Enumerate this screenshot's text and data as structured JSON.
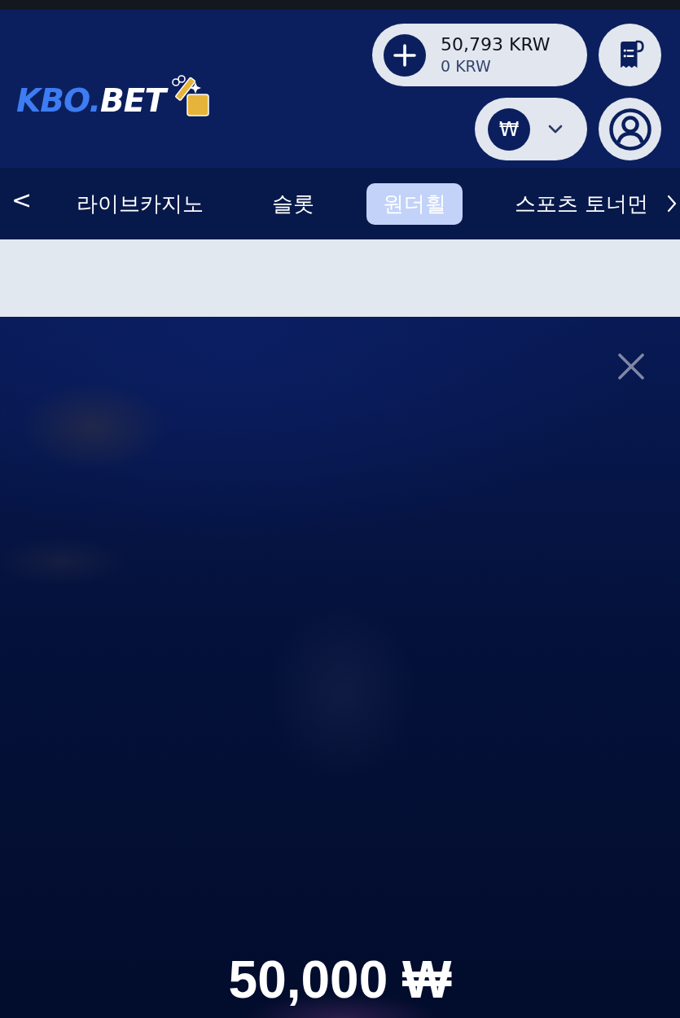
{
  "header": {
    "logo": {
      "accent": "KBO.",
      "text": "BET"
    },
    "balance": {
      "amount": "50,793 KRW",
      "bonus": "0 KRW"
    },
    "currency": {
      "symbol": "₩"
    }
  },
  "nav": {
    "back": "<",
    "tabs": [
      {
        "label": "라이브카지노",
        "selected": false
      },
      {
        "label": "슬롯",
        "selected": false
      },
      {
        "label": "원더휠",
        "selected": true
      },
      {
        "label": "스포츠 토너먼",
        "selected": false
      }
    ]
  },
  "prize": {
    "amount": "50,000 ₩"
  }
}
